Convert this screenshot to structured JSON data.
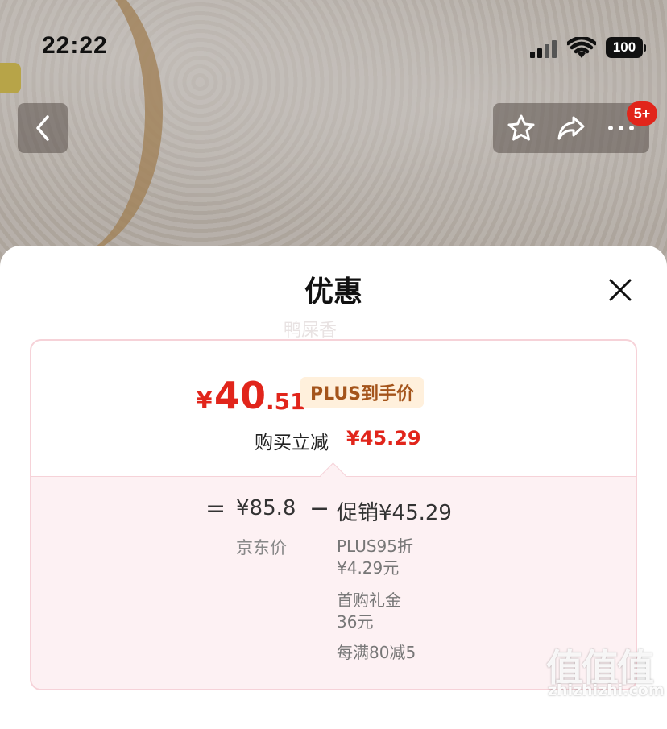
{
  "status_bar": {
    "time": "22:22",
    "battery": "100"
  },
  "nav": {
    "notification_badge": "5+"
  },
  "sheet": {
    "title": "优惠",
    "watermark_text": "鸭屎香"
  },
  "price": {
    "currency": "¥",
    "integer": "40",
    "decimal": ".51",
    "tag": "PLUS到手价",
    "reduce_label": "购买立减",
    "reduce_value": "¥45.29"
  },
  "breakdown": {
    "equals": "=",
    "jd_price": "¥85.8",
    "jd_label": "京东价",
    "minus": "−",
    "promo": "促销¥45.29",
    "details": [
      {
        "line1": "PLUS95折",
        "line2": "¥4.29元"
      },
      {
        "line1": "首购礼金",
        "line2": "36元"
      },
      {
        "line1": "每满80减5",
        "line2": ""
      }
    ]
  },
  "watermark": {
    "logo": "值值值",
    "site": "zhizhizhi.com"
  },
  "colors": {
    "accent_red": "#e1251b",
    "plus_tag_bg": "#fff0dc",
    "plus_tag_text": "#a4541b",
    "card_border": "#f6d2d8"
  }
}
